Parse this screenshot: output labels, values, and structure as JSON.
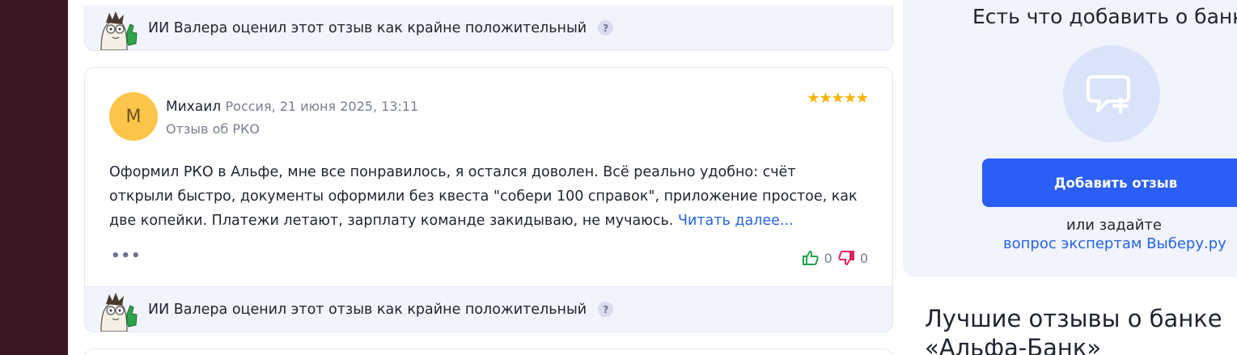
{
  "ai_assessment": {
    "text": "ИИ Валера оценил этот отзыв как крайне положительный",
    "help": "?"
  },
  "review": {
    "avatar_letter": "М",
    "author": "Михаил",
    "meta": "Россия, 21 июня 2025, 13:11",
    "topic": "Отзыв об РКО",
    "stars": "★★★★★",
    "rating": 5,
    "body": "Оформил РКО в Альфе, мне все понравилось, я остался доволен. Всё реально удобно: счёт открыли быстро, документы оформили без квеста \"собери 100 справок\", приложение простое, как две копейки. Платежи летают, зарплату команде закидываю, не мучаюсь.",
    "read_more": "Читать далее...",
    "more": "•••",
    "likes": "0",
    "dislikes": "0"
  },
  "sidebar": {
    "title": "Есть что добавить о банке",
    "add_review_button": "Добавить отзыв",
    "or_ask": "или задайте",
    "ask_experts_link": "вопрос экспертам Выберу.ру",
    "best_reviews_heading": "Лучшие отзывы о банке «Альфа-Банк»"
  },
  "colors": {
    "sidebar_left": "#3d1624",
    "accent_blue": "#2b5ef5",
    "star": "#f5b400",
    "like": "#22a34a",
    "dislike": "#e0245e"
  }
}
